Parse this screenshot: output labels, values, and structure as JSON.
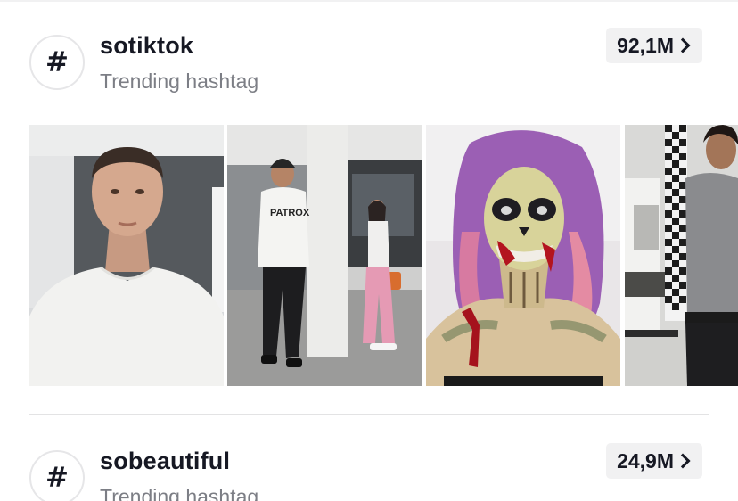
{
  "hashtags": [
    {
      "icon": "hashtag-icon",
      "symbol": "#",
      "name": "sotiktok",
      "subtitle": "Trending hashtag",
      "count": "92,1M"
    },
    {
      "icon": "hashtag-icon",
      "symbol": "#",
      "name": "sobeautiful",
      "subtitle": "Trending hashtag",
      "count": "24,9M"
    }
  ],
  "thumbnails": [
    {
      "description_icon": "video-thumbnail"
    },
    {
      "description_icon": "video-thumbnail"
    },
    {
      "description_icon": "video-thumbnail"
    },
    {
      "description_icon": "video-thumbnail"
    }
  ],
  "colors": {
    "text_primary": "#161823",
    "text_secondary": "#7c7e85",
    "pill_background": "#f1f1f2",
    "divider": "#e3e3e4"
  }
}
